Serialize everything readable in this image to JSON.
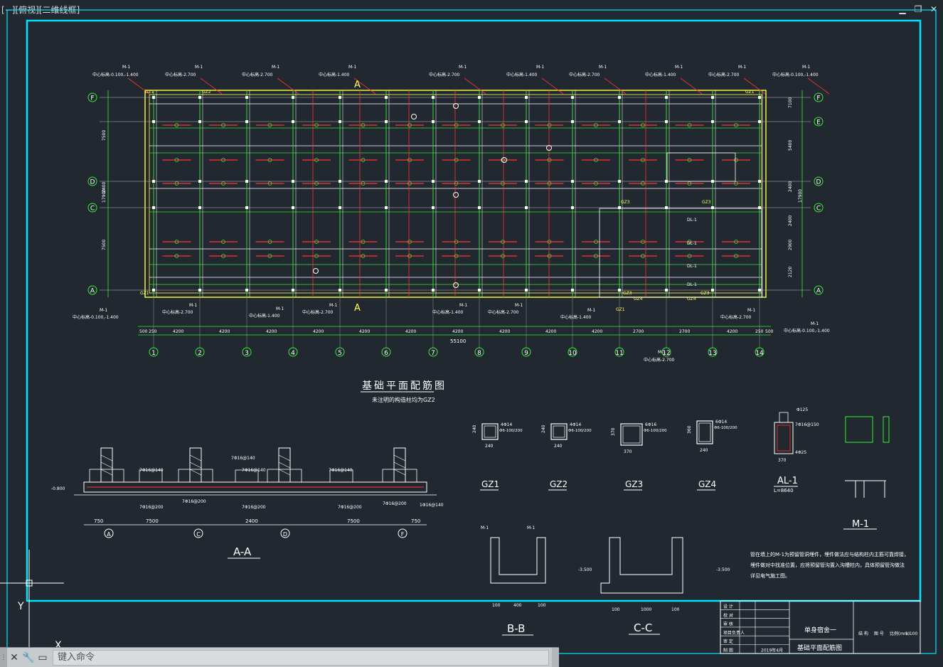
{
  "viewport": {
    "label": "[−][俯视][二维线框]"
  },
  "window_controls": {
    "minimize": "▁",
    "restore": "❐",
    "close": "✕"
  },
  "plan": {
    "title": "基础平面配筋图",
    "subtitle": "未注明的构造柱均为GZ2",
    "axis_letters_left": [
      "F",
      "D",
      "C",
      "A"
    ],
    "axis_letters_right": [
      "F",
      "E",
      "D",
      "C",
      "A"
    ],
    "axis_numbers": [
      "1",
      "2",
      "3",
      "4",
      "5",
      "6",
      "7",
      "8",
      "9",
      "10",
      "11",
      "12",
      "13",
      "14"
    ],
    "bay_dims": [
      "500",
      "250",
      "4200",
      "4200",
      "4200",
      "4200",
      "4200",
      "4200",
      "4200",
      "4200",
      "4200",
      "4200",
      "2700",
      "2700",
      "4200",
      "250",
      "500"
    ],
    "total_dim": "55100",
    "left_dims": [
      "17900",
      "7500",
      "2400",
      "7500"
    ],
    "right_dims": [
      "7100",
      "5400",
      "2400",
      "17900",
      "2400",
      "2900",
      "2120"
    ],
    "section_mark": "A",
    "top_labels": [
      {
        "m": "M-1",
        "h": "中心标高-0.100,-1.400"
      },
      {
        "m": "M-1",
        "h": "中心标高-2.700"
      },
      {
        "m": "M-1",
        "h": "中心标高-2.700"
      },
      {
        "m": "M-1",
        "h": "中心标高-1.400"
      },
      {
        "m": "M-1",
        "h": "中心标高-2.700"
      },
      {
        "m": "M-1",
        "h": "中心标高-1.400"
      },
      {
        "m": "M-1",
        "h": "中心标高-2.700"
      },
      {
        "m": "M-1",
        "h": "中心标高-1.400"
      },
      {
        "m": "M-1",
        "h": "中心标高-2.700"
      },
      {
        "m": "M-1",
        "h": "中心标高-0.100,-1.400"
      }
    ],
    "bottom_labels": [
      {
        "m": "M-1",
        "h": "中心标高-0.100,-1.400"
      },
      {
        "m": "M-1",
        "h": "中心标高-2.700"
      },
      {
        "m": "M-1",
        "h": "中心标高-1.400"
      },
      {
        "m": "M-1",
        "h": "中心标高-2.700"
      },
      {
        "m": "M-1",
        "h": "中心标高-1.400"
      },
      {
        "m": "M-1",
        "h": "中心标高-2.700"
      },
      {
        "m": "M-1",
        "h": "中心标高-1.400"
      },
      {
        "m": "M-1",
        "h": "中心标高-2.700"
      },
      {
        "m": "M-1",
        "h": "中心标高-0.100,-1.400"
      }
    ],
    "bottom_extra": {
      "m": "M-1",
      "h": "中心标高-2.700"
    },
    "dl_labels": [
      "DL-1",
      "DL-1",
      "DL-1",
      "DL-1"
    ],
    "gz_labels": [
      "GZ1",
      "GZ2",
      "GZ1",
      "GZ3",
      "GZ3",
      "GZ3",
      "GZ4",
      "GZ4",
      "GZ3",
      "GZ1",
      "GZ1"
    ]
  },
  "section_aa": {
    "title": "A-A",
    "dims": [
      "750",
      "7500",
      "2400",
      "7500",
      "750"
    ],
    "axes": [
      "A",
      "C",
      "D",
      "F"
    ],
    "rebar_labels": [
      "7Φ16@140",
      "7Φ16@140",
      "7Φ16@140",
      "7Φ16@140",
      "7Φ16@200",
      "7Φ16@200",
      "7Φ16@200",
      "7Φ16@200",
      "7Φ16@200",
      "1Φ16@140"
    ],
    "elev": "-0.800"
  },
  "sections_gz": [
    {
      "name": "GZ1",
      "rebar": "4Φ14",
      "stir": "Φ6-100/200",
      "w": "240",
      "h": "240"
    },
    {
      "name": "GZ2",
      "rebar": "4Φ14",
      "stir": "Φ6-100/200",
      "w": "240",
      "h": "240"
    },
    {
      "name": "GZ3",
      "rebar": "6Φ16",
      "stir": "Φ6-100/200",
      "w": "370",
      "h": "370"
    },
    {
      "name": "GZ4",
      "rebar": "6Φ14",
      "stir": "Φ6-100/200",
      "w": "240",
      "h": "360"
    }
  ],
  "section_al": {
    "title": "AL-1",
    "sub": "L=8640",
    "top": "Φ125",
    "r1": "7Φ16@150",
    "r2": "4Φ25",
    "w": "370",
    "h": "350"
  },
  "section_m1": {
    "title": "M-1"
  },
  "section_bb": {
    "title": "B-B",
    "m1": "M-1",
    "m2": "M-1",
    "elev": "-3.500",
    "d1": "100",
    "d2": "400",
    "d3": "100",
    "h1": "400",
    "h2": "200"
  },
  "section_cc": {
    "title": "C-C",
    "elev": "-3.500",
    "d1": "100",
    "d2": "1000",
    "d3": "100",
    "h1": "500"
  },
  "notes": [
    "管在墙上的M-1为预留管洞埋件，埋件做法应与结构柱内主筋可靠焊接，",
    "埋件做对中找准位置，应将预留管沟置入沟槽柱内，具体预留管沟做法",
    "详见电气施工图。"
  ],
  "title_block": {
    "project": "单身宿舍一",
    "drawing": "基础平面配筋图",
    "rows": [
      "设 计",
      "校 对",
      "审 核",
      "项目负责人",
      "审 定",
      "制 图"
    ],
    "values": [
      "",
      "",
      "",
      "",
      "",
      "2019年4月"
    ],
    "right_heads": [
      "结 构",
      "图 号",
      "比例(mm)",
      "1:100"
    ]
  },
  "command": {
    "placeholder": "键入命令"
  },
  "ucs": {
    "x": "X",
    "y": "Y"
  }
}
